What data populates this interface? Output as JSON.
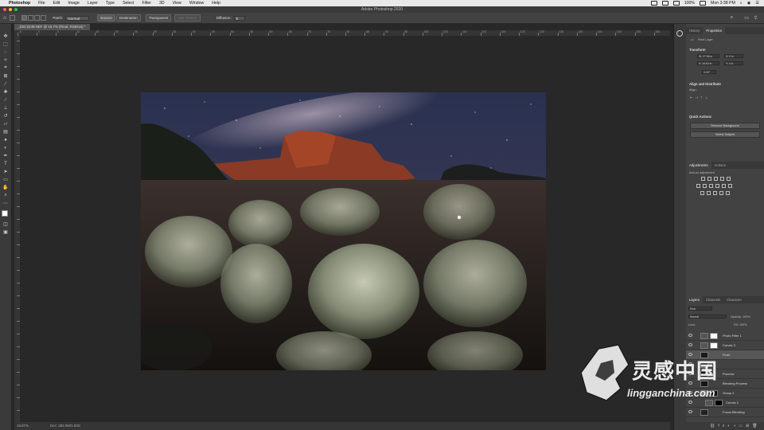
{
  "menubar": {
    "app": "Photoshop",
    "items": [
      "File",
      "Edit",
      "Image",
      "Layer",
      "Type",
      "Select",
      "Filter",
      "3D",
      "View",
      "Window",
      "Help"
    ],
    "battery": "100%",
    "clock": "Mon 3:38 PM"
  },
  "titlebar": {
    "title": "Adobe Photoshop 2020"
  },
  "options": {
    "patch_label": "Patch:",
    "patch_value": "Normal",
    "source": "Source",
    "destination": "Destination",
    "transparent": "Transparent",
    "use_pattern": "Use Pattern",
    "diffusion_label": "Diffusion:",
    "diffusion_value": "5"
  },
  "document": {
    "tab": "_DSC2249.NEF @ 16.7% (Final, RGB/16) *",
    "zoom": "16.67%",
    "doc_info": "Doc: 282.0M/1.50G"
  },
  "ruler_numbers": [
    "-5",
    "0",
    "5",
    "10",
    "15",
    "20",
    "25",
    "30",
    "35",
    "40",
    "45",
    "50",
    "55",
    "60",
    "65",
    "70",
    "75",
    "80",
    "85",
    "90",
    "95",
    "100",
    "105",
    "110",
    "115",
    "120",
    "125",
    "130",
    "135",
    "140",
    "145",
    "150",
    "155",
    "160"
  ],
  "properties": {
    "tabs": [
      "History",
      "Properties"
    ],
    "layer_kind": "Pixel Layer",
    "transform": "Transform",
    "w": "W: 27.96 in",
    "h": "H: 18.64 in",
    "x": "X: 0 in",
    "y": "Y: 0 in",
    "angle": "0.00°",
    "align": "Align and Distribute",
    "align_sub": "Align:",
    "quick_actions": "Quick Actions",
    "remove_bg": "Remove Background",
    "select_subject": "Select Subject"
  },
  "adjustments": {
    "tabs": [
      "Adjustments",
      "Actions"
    ],
    "add": "Add an adjustment"
  },
  "layers_panel": {
    "tabs": [
      "Layers",
      "Channels",
      "Character"
    ],
    "kind": "Kind",
    "blend": "Normal",
    "opacity": "Opacity: 100%",
    "lock": "Lock:",
    "fill": "Fill: 100%",
    "layers": [
      {
        "name": "Photo Filter 1",
        "thumb": "#ffffff"
      },
      {
        "name": "Curves 3",
        "thumb": "#ffffff"
      },
      {
        "name": "Final",
        "thumb": "#1a1a1a",
        "selected": true
      },
      {
        "name": "",
        "thumb": "#111111"
      },
      {
        "name": "Process",
        "thumb": "#0e0e0e"
      },
      {
        "name": "Blending Process",
        "thumb": "#151515"
      },
      {
        "name": "Group 1",
        "thumb": "#111111"
      },
      {
        "name": "Curves 1",
        "thumb": "#000000"
      },
      {
        "name": "Focus Blending",
        "thumb": "#222222"
      }
    ]
  },
  "watermark": {
    "cn": "灵感中国",
    "url": "lingganchina.com"
  },
  "colors": {
    "accent": "#2d7ae0",
    "panel": "#424242",
    "canvas": "#282828"
  }
}
